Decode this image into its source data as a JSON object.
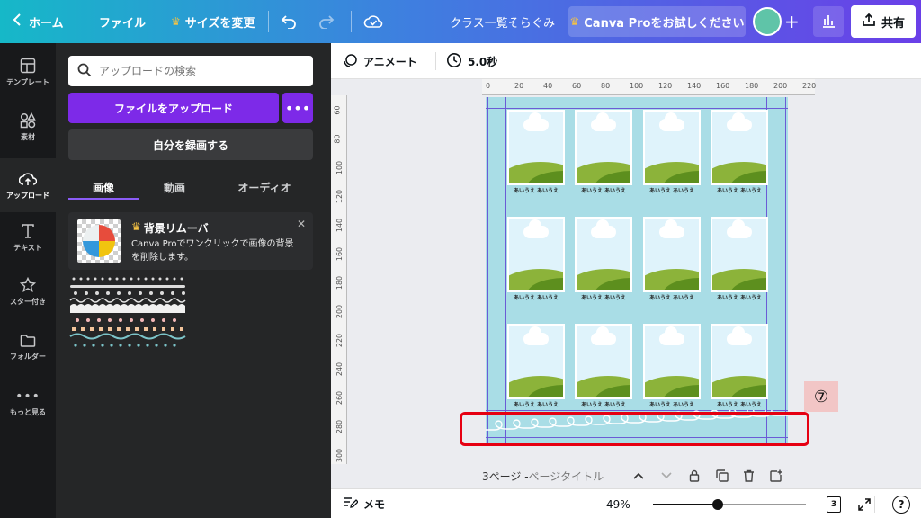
{
  "topbar": {
    "home_label": "ホーム",
    "file_label": "ファイル",
    "resize_label": "サイズを変更",
    "doc_title": "クラス一覧そらぐみ",
    "pro_label": "Canva Proをお試しください",
    "share_label": "共有",
    "avatar_color": "#5fc4a8"
  },
  "sidebar": {
    "items": [
      {
        "label": "テンプレート",
        "icon": "template-icon"
      },
      {
        "label": "素材",
        "icon": "elements-icon"
      },
      {
        "label": "アップロード",
        "icon": "upload-cloud-icon",
        "active": true
      },
      {
        "label": "テキスト",
        "icon": "text-icon"
      },
      {
        "label": "スター付き",
        "icon": "star-icon"
      },
      {
        "label": "フォルダー",
        "icon": "folder-icon"
      },
      {
        "label": "もっと見る",
        "icon": "more-icon"
      }
    ]
  },
  "panel": {
    "search_placeholder": "アップロードの検索",
    "upload_label": "ファイルをアップロード",
    "more_label": "•••",
    "record_label": "自分を録画する",
    "tabs": [
      {
        "label": "画像",
        "active": true
      },
      {
        "label": "動画"
      },
      {
        "label": "オーディオ"
      }
    ],
    "promo": {
      "title": "背景リムーバ",
      "description": "Canva Proでワンクリックで画像の背景を削除します。"
    }
  },
  "editor": {
    "animate_label": "アニメート",
    "duration_label": "5.0秒",
    "hruler_ticks": [
      "0",
      "20",
      "40",
      "60",
      "80",
      "100",
      "120",
      "140",
      "160",
      "180",
      "200",
      "220"
    ],
    "vruler_ticks": [
      "60",
      "80",
      "100",
      "120",
      "140",
      "160",
      "180",
      "200",
      "220",
      "240",
      "260",
      "280",
      "300"
    ],
    "frame_label": "あいうえ あいうえ",
    "page_label": "3ページ - ",
    "page_title_placeholder": "ページタイトル",
    "callout_number": "⑦",
    "page_bg_color": "#a9dde6",
    "callout_color": "#e60012"
  },
  "bottombar": {
    "notes_label": "メモ",
    "zoom_label": "49%",
    "zoom_fraction": 0.49,
    "page_count": "3",
    "help_label": "?"
  }
}
